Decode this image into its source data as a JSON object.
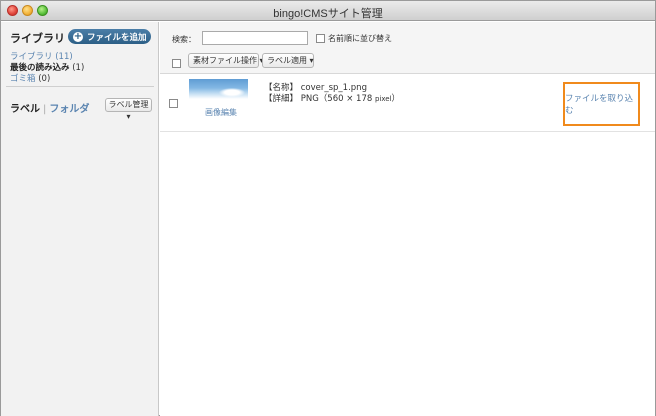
{
  "window": {
    "title": "bingo!CMSサイト管理"
  },
  "sidebar": {
    "library_title": "ライブラリ",
    "add_file_label": "ファイルを追加",
    "nav": [
      {
        "label": "ライブラリ",
        "count": "(11)"
      },
      {
        "label": "最後の読み込み",
        "count": "(1)"
      },
      {
        "label": "ゴミ箱",
        "count": "(0)"
      }
    ],
    "label_tab": "ラベル",
    "folder_tab": "フォルダ",
    "label_manage": "ラベル管理 ▾"
  },
  "toolbar": {
    "search_label": "検索：",
    "search_value": "",
    "sort_label": "名前順に並び替え",
    "file_ops": "素材ファイル操作 ▾",
    "apply_label": "ラベル適用 ▾"
  },
  "files": [
    {
      "name_label": "【名称】",
      "name": "cover_sp_1.png",
      "detail_label": "【詳細】",
      "detail": "PNG（560 × 178",
      "detail_unit": "pixel",
      "detail_close": "）",
      "edit_label": "画像編集",
      "import_label": "ファイルを取り込む"
    }
  ],
  "colors": {
    "link": "#5a84b0",
    "add_button": "#2c5f86",
    "highlight": "#f08a1c"
  }
}
